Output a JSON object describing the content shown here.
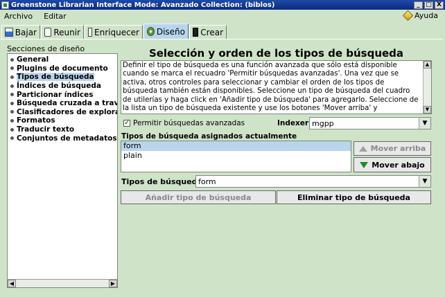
{
  "window": {
    "title": "Greenstone Librarian Interface Mode: Avanzado Collection: (biblos)",
    "btn_minimize": "_",
    "btn_maximize": "□",
    "btn_close": "X"
  },
  "menu": {
    "archivo": "Archivo",
    "editar": "Editar",
    "ayuda": "Ayuda"
  },
  "tabs": [
    {
      "label": "Bajar",
      "icon": "download-icon"
    },
    {
      "label": "Reunir",
      "icon": "gather-icon"
    },
    {
      "label": "Enriquecer",
      "icon": "enrich-icon"
    },
    {
      "label": "Diseño",
      "icon": "design-gear-icon",
      "active": true
    },
    {
      "label": "Crear",
      "icon": "create-icon"
    }
  ],
  "sidebar": {
    "title": "Secciones de diseño",
    "items": [
      "General",
      "Plugins de documento",
      "Tipos de búsqueda",
      "Índices de búsqueda",
      "Particionar índices",
      "Búsqueda cruzada a través",
      "Clasificadores de exploraci",
      "Formatos",
      "Traducir texto",
      "Conjuntos de metadatos"
    ],
    "selected_index": 2
  },
  "main": {
    "heading": "Selección y orden de los tipos de búsqueda",
    "description": "Definir el tipo de búsqueda es una función avanzada que sólo está disponible cuando se marca el recuadro 'Permitir búsquedas avanzadas'. Una vez que se activa, otros controles para seleccionar y cambiar el orden de los tipos de búsqueda también están disponibles. Seleccione un tipo de búsqueda del cuadro de utilerías y haga click en 'Añadir tipo de búsqueda' para agregarlo. Seleccione de la lista un tipo de búsqueda existente y use los botones 'Mover arriba' y",
    "advanced_checkbox_label": "Permitir búsquedas avanzadas",
    "advanced_checked": true,
    "check_mark": "✓",
    "indexer_label": "Indexer:",
    "indexer_value": "mgpp",
    "assigned_label": "Tipos de búsqueda asignados actualmente",
    "assigned_items": [
      "form",
      "plain"
    ],
    "move_up_label": "Mover arriba",
    "move_down_label": "Mover abajo",
    "types_label": "Tipos de búsqueda:",
    "types_value": "form",
    "add_button": "Añadir tipo de búsqueda",
    "remove_button": "Eliminar tipo de búsqueda"
  },
  "glyphs": {
    "dropdown": "▼",
    "up": "▲",
    "down": "▼",
    "left": "◀",
    "right": "▶"
  }
}
